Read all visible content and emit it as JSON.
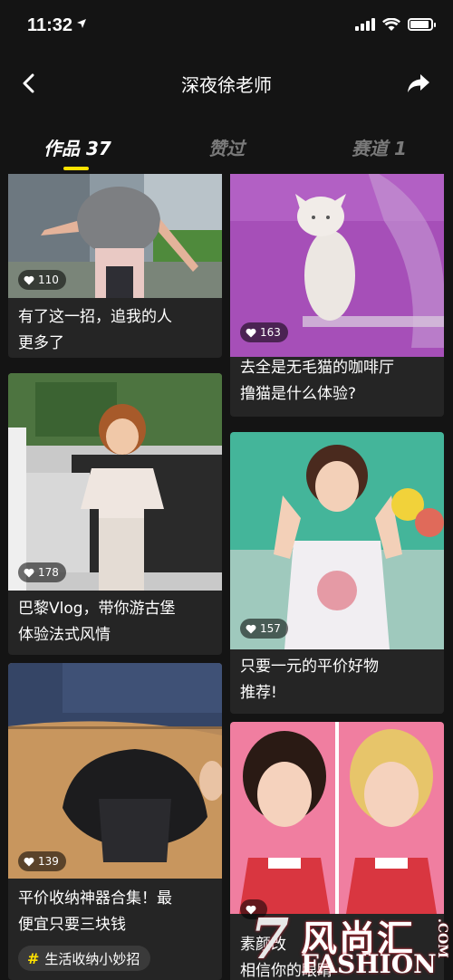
{
  "status_bar": {
    "time": "11:32",
    "battery_level": 0.9
  },
  "nav": {
    "title": "深夜徐老师",
    "back_icon": "chevron-left-icon",
    "share_icon": "share-arrow-icon"
  },
  "tabs": [
    {
      "label": "作品 37",
      "active": true
    },
    {
      "label": "赞过",
      "active": false
    },
    {
      "label": "赛道 1",
      "active": false
    }
  ],
  "colors": {
    "accent": "#ffe200",
    "background": "#141414",
    "card": "#252525"
  },
  "cards": [
    {
      "title": "有了这一招，追我的人更多了",
      "title_lines": [
        "有了这一招，追我的人",
        "更多了"
      ],
      "likes": "110"
    },
    {
      "title": "去全是无毛猫的咖啡厅撸猫是什么体验?",
      "title_lines": [
        "去全是无毛猫的咖啡厅",
        "撸猫是什么体验?"
      ],
      "likes": "163"
    },
    {
      "title": "巴黎Vlog，带你游古堡体验法式风情",
      "title_lines": [
        "巴黎Vlog，带你游古堡",
        "体验法式风情"
      ],
      "likes": "178"
    },
    {
      "title": "只要一元的平价好物推荐!",
      "title_lines": [
        "只要一元的平价好物",
        "推荐!"
      ],
      "likes": "157"
    },
    {
      "title": "平价收纳神器合集！最便宜只要三块钱",
      "title_lines": [
        "平价收纳神器合集！最",
        "便宜只要三块钱"
      ],
      "likes": "139",
      "topic": "生活收纳小妙招"
    },
    {
      "title_lines": [
        "素颜改",
        "相信你的眼睛"
      ],
      "likes": ""
    }
  ],
  "watermark": {
    "digit": "7",
    "cn": "风尚汇",
    "en": "FASHION",
    "com": ".COM"
  }
}
